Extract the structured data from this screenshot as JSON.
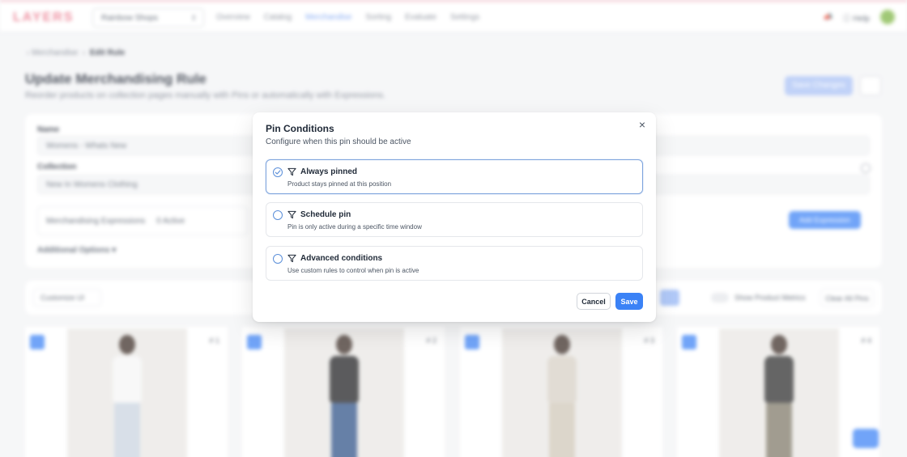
{
  "app": {
    "logo": "LAYERS",
    "store": "Rainbow Shops",
    "nav": [
      "Overview",
      "Catalog",
      "Merchandise",
      "Sorting",
      "Evaluate",
      "Settings"
    ],
    "help": "Help"
  },
  "page": {
    "breadcrumb_parent": "Merchandise",
    "breadcrumb_current": "Edit Rule",
    "title": "Update Merchandising Rule",
    "subtitle": "Reorder products on collection pages manually with Pins or automatically with Expressions.",
    "save_changes": "Save Changes"
  },
  "form": {
    "name_label": "Name",
    "name_value": "Womens - Whats New",
    "collection_label": "Collection",
    "collection_value": "New In Womens Clothing",
    "expressions_label": "Merchandising Expressions",
    "expressions_count": "0 Active",
    "add_expression": "Add Expression",
    "additional_options": "Additional Options"
  },
  "toolbar": {
    "customize": "Customize UI",
    "show_metrics": "Show Product Metrics",
    "clear_pins": "Clear All Pins"
  },
  "products": [
    {
      "pin": "1",
      "position": "1",
      "top_color": "#f5f5f5",
      "bottom_color": "#c9d3e0"
    },
    {
      "pin": "2",
      "position": "2",
      "top_color": "#1d1d1f",
      "bottom_color": "#2c4f86"
    },
    {
      "pin": "3",
      "position": "3",
      "top_color": "#d6cfc4",
      "bottom_color": "#cfc6b7"
    },
    {
      "pin": "4",
      "position": "4",
      "top_color": "#2a2a2a",
      "bottom_color": "#7d7766"
    }
  ],
  "modal": {
    "title": "Pin Conditions",
    "subtitle": "Configure when this pin should be active",
    "close_icon": "close-icon",
    "options": [
      {
        "label": "Always pinned",
        "description": "Product stays pinned at this position",
        "selected": true
      },
      {
        "label": "Schedule pin",
        "description": "Pin is only active during a specific time window",
        "selected": false
      },
      {
        "label": "Advanced conditions",
        "description": "Use custom rules to control when pin is active",
        "selected": false
      }
    ],
    "cancel": "Cancel",
    "save": "Save"
  },
  "colors": {
    "accent": "#3b82f6",
    "selected_border": "#7da4dd",
    "logo": "#e8677e"
  }
}
